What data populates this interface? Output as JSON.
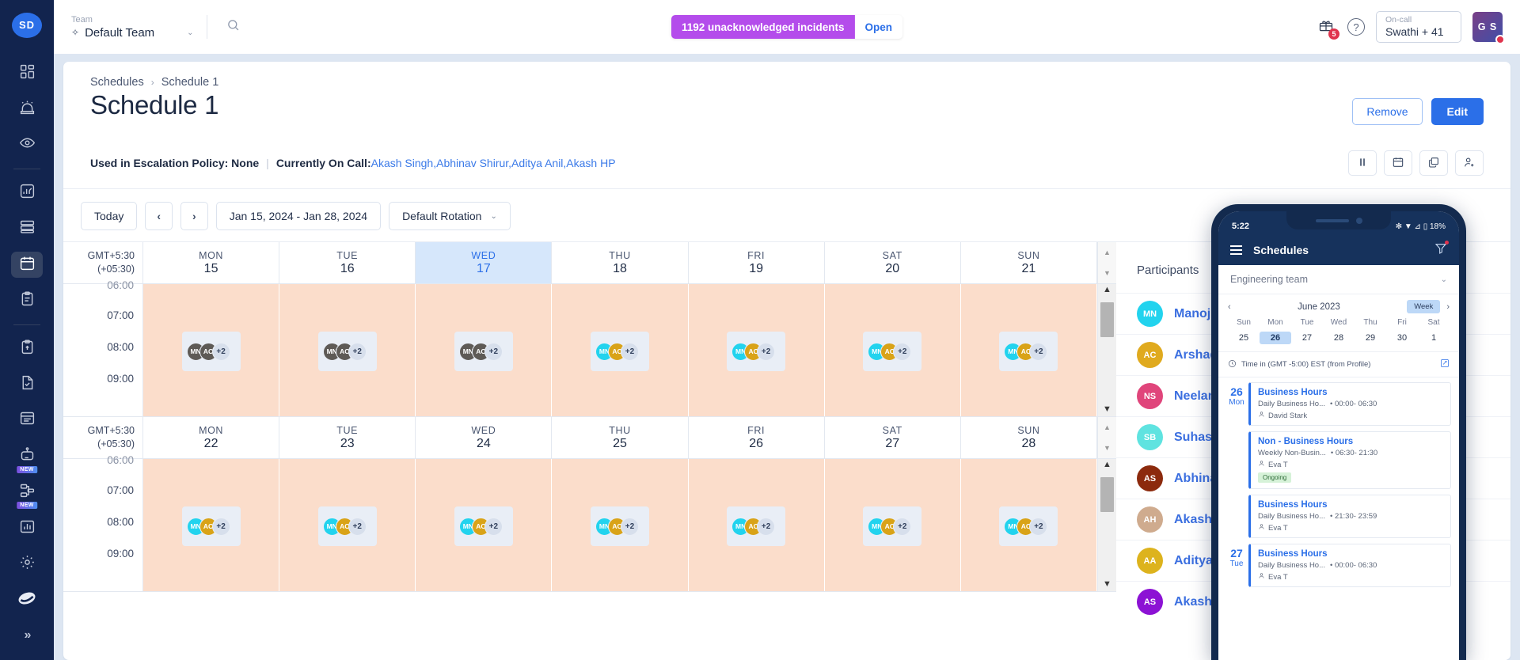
{
  "rail": {
    "logo": "SD",
    "items": [
      {
        "name": "dashboard",
        "icon": "grid-icon"
      },
      {
        "name": "incidents",
        "icon": "siren-icon"
      },
      {
        "name": "watch",
        "icon": "eye-icon"
      },
      {
        "name": "analytics",
        "icon": "chart-box-icon"
      },
      {
        "name": "services",
        "icon": "server-icon"
      },
      {
        "name": "schedules",
        "icon": "calendar-icon",
        "active": true
      },
      {
        "name": "postmortem",
        "icon": "clipboard-icon"
      },
      {
        "name": "runbooks",
        "icon": "clipboard-up-icon"
      },
      {
        "name": "tasks",
        "icon": "file-check-icon"
      },
      {
        "name": "status-page",
        "icon": "window-icon"
      },
      {
        "name": "automation",
        "icon": "robot-icon",
        "badge": "NEW"
      },
      {
        "name": "workflows",
        "icon": "workflow-icon",
        "badge": "NEW"
      },
      {
        "name": "reports",
        "icon": "bar-chart-icon"
      },
      {
        "name": "settings",
        "icon": "gear-icon"
      }
    ],
    "expand": "»"
  },
  "topbar": {
    "team_label": "Team",
    "team_value": "Default Team",
    "search_placeholder": "Search",
    "banner_count": "1192 unacknowledged incidents",
    "banner_open": "Open",
    "gift_count": "5",
    "help": "?",
    "oncall_label": "On-call",
    "oncall_value": "Swathi + 41",
    "user_initials": "G S"
  },
  "page": {
    "breadcrumb_root": "Schedules",
    "breadcrumb_sep": "›",
    "breadcrumb_current": "Schedule 1",
    "title": "Schedule 1",
    "remove_label": "Remove",
    "edit_label": "Edit",
    "meta_policy_label": "Used in Escalation Policy:",
    "meta_policy_value": "None",
    "meta_divider": "|",
    "meta_oncall_label": "Currently On Call:",
    "meta_oncall_value": "Akash Singh,Abhinav Shirur,Aditya Anil,Akash HP",
    "meta_actions": [
      {
        "name": "pause-schedule-button",
        "icon": "pause-icon"
      },
      {
        "name": "calendar-view-button",
        "icon": "calendar-icon"
      },
      {
        "name": "clone-schedule-button",
        "icon": "copy-icon"
      },
      {
        "name": "add-participant-button",
        "icon": "user-plus-icon"
      }
    ]
  },
  "toolbar": {
    "today": "Today",
    "prev": "‹",
    "next": "›",
    "range": "Jan 15, 2024 - Jan 28, 2024",
    "rotation": "Default Rotation",
    "rotation_caret": "⌄"
  },
  "calendar": {
    "timezone_line1": "GMT+5:30",
    "timezone_line2": "(+05:30)",
    "hours": [
      "06:00",
      "07:00",
      "08:00",
      "09:00"
    ],
    "weeks": [
      {
        "days": [
          {
            "dow": "MON",
            "num": "15",
            "today": false,
            "past": true
          },
          {
            "dow": "TUE",
            "num": "16",
            "today": false,
            "past": true
          },
          {
            "dow": "WED",
            "num": "17",
            "today": true,
            "past": true
          },
          {
            "dow": "THU",
            "num": "18",
            "today": false,
            "past": false
          },
          {
            "dow": "FRI",
            "num": "19",
            "today": false,
            "past": false
          },
          {
            "dow": "SAT",
            "num": "20",
            "today": false,
            "past": false
          },
          {
            "dow": "SUN",
            "num": "21",
            "today": false,
            "past": false
          }
        ]
      },
      {
        "days": [
          {
            "dow": "MON",
            "num": "22",
            "today": false,
            "past": false
          },
          {
            "dow": "TUE",
            "num": "23",
            "today": false,
            "past": false
          },
          {
            "dow": "WED",
            "num": "24",
            "today": false,
            "past": false
          },
          {
            "dow": "THU",
            "num": "25",
            "today": false,
            "past": false
          },
          {
            "dow": "FRI",
            "num": "26",
            "today": false,
            "past": false
          },
          {
            "dow": "SAT",
            "num": "27",
            "today": false,
            "past": false
          },
          {
            "dow": "SUN",
            "num": "28",
            "today": false,
            "past": false
          }
        ]
      }
    ],
    "shift": {
      "avatar1": "MN",
      "avatar1_color": "#22d3ee",
      "avatar2": "AC",
      "avatar2_color": "#d9a318",
      "overflow": "+2",
      "past_color": "#5e5a56"
    }
  },
  "participants": {
    "title": "Participants",
    "items": [
      {
        "initials": "MN",
        "name": "Manoj NN",
        "color": "#22d3ee"
      },
      {
        "initials": "AC",
        "name": "Arshad cp",
        "color": "#e0aa1e"
      },
      {
        "initials": "NS",
        "name": "Neelam Sapkota",
        "color": "#e0457b"
      },
      {
        "initials": "SB",
        "name": "Suhas Bhat",
        "color": "#5fe3e0"
      },
      {
        "initials": "AS",
        "name": "Abhinav Shirur",
        "color": "#8c2a0d"
      },
      {
        "initials": "AH",
        "name": "Akash HP",
        "color": "#cfab8e"
      },
      {
        "initials": "AA",
        "name": "Aditya Anil",
        "color": "#ddb31d"
      },
      {
        "initials": "AS",
        "name": "Akash Singh",
        "color": "#8c12d4"
      }
    ]
  },
  "phone": {
    "status_time": "5:22",
    "status_icons": "✻ ▼ ⊿ ▯ 18%",
    "header_title": "Schedules",
    "team_select": "Engineering team",
    "month": "June 2023",
    "view_label": "Week",
    "prev": "‹",
    "next": "›",
    "dows": [
      "Sun",
      "Mon",
      "Tue",
      "Wed",
      "Thu",
      "Fri",
      "Sat"
    ],
    "nums": [
      "25",
      "26",
      "27",
      "28",
      "29",
      "30",
      "1"
    ],
    "selected_num": "26",
    "timezone_note": "Time in (GMT -5:00) EST (from Profile)",
    "days": [
      {
        "num": "26",
        "dow": "Mon",
        "events": [
          {
            "title": "Business Hours",
            "sub": "Daily Business Ho...",
            "time": "• 00:00- 06:30",
            "person": "David Stark",
            "badge": ""
          },
          {
            "title": "Non - Business Hours",
            "sub": "Weekly Non-Busin...",
            "time": "• 06:30- 21:30",
            "person": "Eva T",
            "badge": "Ongoing"
          },
          {
            "title": "Business Hours",
            "sub": "Daily Business Ho...",
            "time": "• 21:30- 23:59",
            "person": "Eva T",
            "badge": ""
          }
        ]
      },
      {
        "num": "27",
        "dow": "Tue",
        "events": [
          {
            "title": "Business Hours",
            "sub": "Daily Business Ho...",
            "time": "• 00:00- 06:30",
            "person": "Eva T",
            "badge": ""
          }
        ]
      }
    ]
  }
}
